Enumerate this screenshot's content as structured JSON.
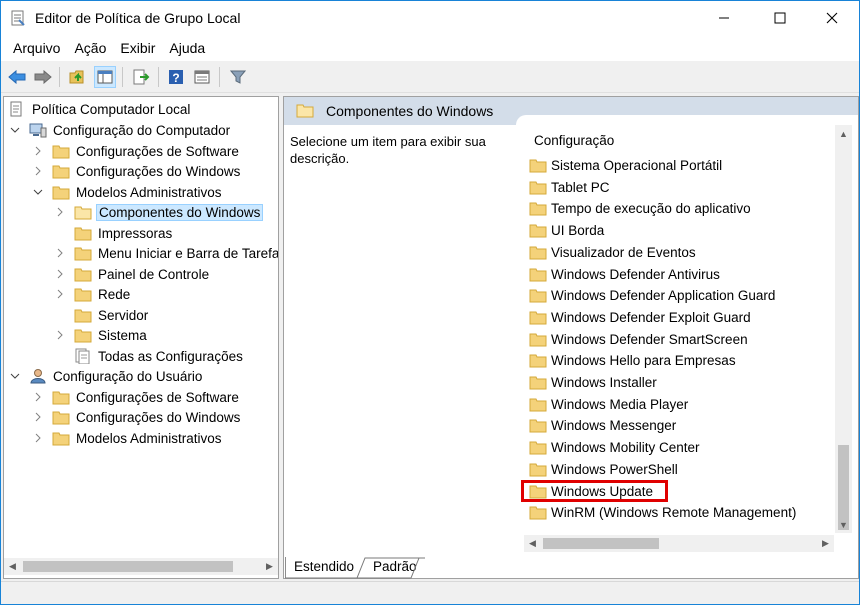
{
  "window": {
    "title": "Editor de Política de Grupo Local"
  },
  "menu": {
    "items": [
      "Arquivo",
      "Ação",
      "Exibir",
      "Ajuda"
    ]
  },
  "toolbar": {
    "buttons": [
      "back-arrow-icon",
      "forward-arrow-icon",
      "up-folder-icon",
      "show-hide-tree-icon",
      "export-list-icon",
      "help-icon",
      "properties-view-icon",
      "filter-icon"
    ]
  },
  "tree": {
    "root": "Política Computador Local",
    "computer_config": "Configuração do Computador",
    "cc_software": "Configurações de Software",
    "cc_windows": "Configurações do Windows",
    "cc_admin": "Modelos Administrativos",
    "windows_components": "Componentes do Windows",
    "printers": "Impressoras",
    "start_menu": "Menu Iniciar e Barra de Tarefas",
    "control_panel": "Painel de Controle",
    "network": "Rede",
    "server": "Servidor",
    "system": "Sistema",
    "all_settings": "Todas as Configurações",
    "user_config": "Configuração do Usuário",
    "uc_software": "Configurações de Software",
    "uc_windows": "Configurações do Windows",
    "uc_admin": "Modelos Administrativos"
  },
  "right": {
    "header": "Componentes do Windows",
    "description": "Selecione um item para exibir sua descrição.",
    "column_header": "Configuração",
    "items": [
      "Sistema Operacional Portátil",
      "Tablet PC",
      "Tempo de execução do aplicativo",
      "UI Borda",
      "Visualizador de Eventos",
      "Windows Defender Antivirus",
      "Windows Defender Application Guard",
      "Windows Defender Exploit Guard",
      "Windows Defender SmartScreen",
      "Windows Hello para Empresas",
      "Windows Installer",
      "Windows Media Player",
      "Windows Messenger",
      "Windows Mobility Center",
      "Windows PowerShell",
      "Windows Update",
      "WinRM (Windows Remote Management)"
    ],
    "highlighted": "Windows Update"
  },
  "tabs": {
    "extended": "Estendido",
    "standard": "Padrão"
  },
  "colors": {
    "folder": "#e8c25a",
    "highlight_border": "#e00000",
    "selection": "#cce8ff",
    "header_band": "#d3dde9"
  }
}
